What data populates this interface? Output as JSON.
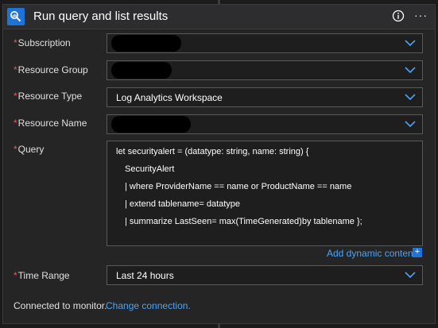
{
  "header": {
    "title": "Run query and list results",
    "info_icon": "info-icon",
    "more_icon": "more-options-icon",
    "more_glyph": "···"
  },
  "form": {
    "required_mark": "*",
    "subscription": {
      "label": "Subscription",
      "value": ""
    },
    "resource_group": {
      "label": "Resource Group",
      "value": ""
    },
    "resource_type": {
      "label": "Resource Type",
      "value": "Log Analytics Workspace"
    },
    "resource_name": {
      "label": "Resource Name",
      "value": ""
    },
    "query": {
      "label": "Query",
      "lines": [
        "let securityalert = (datatype: string, name: string) {",
        "SecurityAlert",
        "| where ProviderName == name or ProductName == name",
        "| extend tablename= datatype",
        "| summarize LastSeen= max(TimeGenerated)by tablename };"
      ]
    },
    "add_dynamic_content": "Add dynamic content",
    "add_dynamic_icon": "+",
    "time_range": {
      "label": "Time Range",
      "value": "Last 24 hours"
    }
  },
  "footer": {
    "connected_text": "Connected to monitor.",
    "change_connection": "Change connection."
  },
  "colors": {
    "accent": "#1e73d6",
    "link": "#4ba3f5",
    "required": "#e05d5d"
  }
}
